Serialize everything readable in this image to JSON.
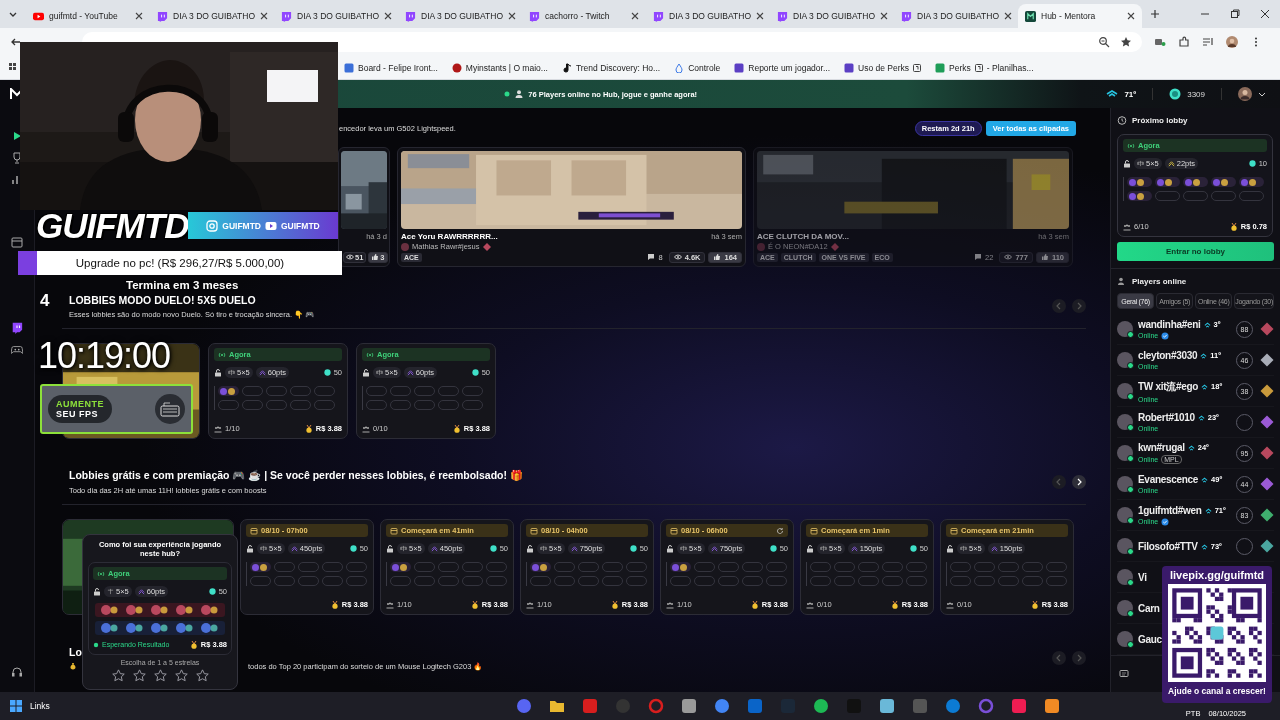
{
  "browser": {
    "tabs": [
      {
        "title": "guifmtd - YouTube",
        "kind": "youtube",
        "selected": false
      },
      {
        "title": "DIA 3 DO GUIBATHO",
        "kind": "twitch",
        "selected": false
      },
      {
        "title": "DIA 3 DO GUIBATHO",
        "kind": "twitch",
        "selected": false
      },
      {
        "title": "DIA 3 DO GUIBATHO",
        "kind": "twitch",
        "selected": false
      },
      {
        "title": "cachorro - Twitch",
        "kind": "twitch",
        "selected": false
      },
      {
        "title": "DIA 3 DO GUIBATHO",
        "kind": "twitch",
        "selected": false
      },
      {
        "title": "DIA 3 DO GUIBATHO",
        "kind": "twitch",
        "selected": false
      },
      {
        "title": "DIA 3 DO GUIBATHO",
        "kind": "twitch",
        "selected": false
      },
      {
        "title": "Hub - Mentora",
        "kind": "mentora",
        "selected": true
      }
    ],
    "bookmarks": [
      {
        "label": "Board - Felipe Iront..."
      },
      {
        "label": "Myinstants | O maio..."
      },
      {
        "label": "Trend Discovery: Ho..."
      },
      {
        "label": "Controle"
      },
      {
        "label": "Reporte um jogador..."
      },
      {
        "label": "Uso de Perks",
        "boxed": true
      },
      {
        "label": "Perks",
        "boxed": true,
        "suffix": "- Planilhas..."
      }
    ]
  },
  "hub": {
    "banner": "76 Players online no Hub, jogue e ganhe agora!",
    "xp": "71º",
    "coins": "3309",
    "clips": {
      "caption": "encedor leva um G502 Lightspeed.",
      "countdown": "Restam 2d 21h",
      "view_all": "Ver todas as clipadas",
      "items": [
        {
          "time": "há 3 d",
          "views": "51",
          "likes": "3",
          "dimmed": false
        },
        {
          "title": "Ace Yoru RAWRRRRRR...",
          "time": "há 3 sem",
          "author": "Mathias Rawr#jesus",
          "tags": [
            "ACE"
          ],
          "comments": "8",
          "views": "4.6K",
          "likes": "164",
          "dimmed": false
        },
        {
          "title": "ACE CLUTCH DA MOV...",
          "time": "há 3 sem",
          "author": "É O NEON#DA12",
          "tags": [
            "ACE",
            "CLUTCH",
            "ONE VS FIVE",
            "ECO"
          ],
          "comments": "22",
          "views": "777",
          "likes": "110",
          "dimmed": true
        }
      ]
    },
    "sections": [
      {
        "number": "4",
        "title": "LOBBIES MODO DUELO! 5X5 DUELO",
        "description": "Esses lobbies são do modo novo Duelo. Só tiro e trocação sincera. 👇 🎮",
        "next_enabled": false,
        "cards": [
          {
            "kind": "picture"
          },
          {
            "kind": "live-lobby",
            "header": "Agora",
            "mode": "5×5",
            "points": "60pts",
            "entry": "50",
            "slots": [
              true,
              false,
              false,
              false,
              false,
              false,
              false,
              false,
              false,
              false
            ],
            "count": "1/10",
            "prize": "R$ 3.88"
          },
          {
            "kind": "live-lobby",
            "header": "Agora",
            "mode": "5×5",
            "points": "60pts",
            "entry": "50",
            "slots": [
              false,
              false,
              false,
              false,
              false,
              false,
              false,
              false,
              false,
              false
            ],
            "count": "0/10",
            "prize": "R$ 3.88"
          }
        ]
      },
      {
        "title": "Lobbies grátis e com premiação 🎮 ☕ | Se você perder nesses lobbies, é reembolsado! 🎁",
        "description": "Todo dia das 2H até umas 11H! lobbies grátis e com boosts",
        "next_enabled": true,
        "cards": [
          {
            "kind": "picture"
          },
          {
            "kind": "scheduled-lobby",
            "header": "08/10 - 07h00",
            "mode": "5×5",
            "points": "450pts",
            "entry": "50",
            "slots": [
              true,
              false,
              false,
              false,
              false,
              false,
              false,
              false,
              false,
              false
            ],
            "prize": "R$ 3.88"
          },
          {
            "kind": "scheduled-lobby",
            "header": "Começará em 41min",
            "mode": "5×5",
            "points": "450pts",
            "entry": "50",
            "slots": [
              true,
              false,
              false,
              false,
              false,
              false,
              false,
              false,
              false,
              false
            ],
            "count": "1/10",
            "prize": "R$ 3.88"
          },
          {
            "kind": "scheduled-lobby",
            "header": "08/10 - 04h00",
            "mode": "5×5",
            "points": "750pts",
            "entry": "50",
            "slots": [
              true,
              false,
              false,
              false,
              false,
              false,
              false,
              false,
              false,
              false
            ],
            "count": "1/10",
            "prize": "R$ 3.88"
          },
          {
            "kind": "scheduled-lobby",
            "header": "08/10 - 06h00",
            "refresh": true,
            "mode": "5×5",
            "points": "750pts",
            "entry": "50",
            "slots": [
              true,
              false,
              false,
              false,
              false,
              false,
              false,
              false,
              false,
              false
            ],
            "count": "1/10",
            "prize": "R$ 3.88"
          },
          {
            "kind": "scheduled-lobby",
            "header": "Começará em 1min",
            "mode": "5×5",
            "points": "150pts",
            "entry": "50",
            "slots": [
              false,
              false,
              false,
              false,
              false,
              false,
              false,
              false,
              false,
              false
            ],
            "count": "0/10",
            "prize": "R$ 3.88"
          },
          {
            "kind": "scheduled-lobby",
            "header": "Começará em 21min",
            "mode": "5×5",
            "points": "150pts",
            "slots": [
              false,
              false,
              false,
              false,
              false,
              false,
              false,
              false,
              false,
              false
            ],
            "count": "0/10",
            "prize": "R$ 3.88"
          }
        ]
      },
      {
        "title": "Lo",
        "description": "todos do Top 20 participam do sorteio de um Mouse Logitech G203 🔥",
        "next_enabled": false
      }
    ],
    "next_lobby": {
      "title": "Próximo lobby",
      "header": "Agora",
      "mode": "5×5",
      "points": "22pts",
      "entry": "10",
      "slots": [
        true,
        true,
        true,
        true,
        true,
        true,
        false,
        false,
        false,
        false
      ],
      "count": "6/10",
      "prize": "R$ 0.78",
      "join": "Entrar no lobby"
    },
    "players": {
      "title": "Players online",
      "tabs": [
        {
          "label": "Geral (76)",
          "selected": true
        },
        {
          "label": "Amigos (5)",
          "selected": false
        },
        {
          "label": "Online (46)",
          "selected": false
        },
        {
          "label": "Jogando (30)",
          "selected": false
        }
      ],
      "list": [
        {
          "name": "wandinha#eni",
          "rank": "3º",
          "status": "Online",
          "verified": true,
          "badge": "88",
          "color": "#b8485e"
        },
        {
          "name": "cleyton#3030",
          "rank": "11º",
          "status": "Online",
          "verified": false,
          "badge": "46",
          "color": "#a9adb8"
        },
        {
          "name": "TW xit流#ego",
          "rank": "18º",
          "status": "Online",
          "verified": false,
          "badge": "38",
          "color": "#c99a3c"
        },
        {
          "name": "Robert#1010",
          "rank": "23º",
          "status": "Online",
          "verified": false,
          "color": "#9b5ad6"
        },
        {
          "name": "kwn#rugal",
          "rank": "24º",
          "status": "Online",
          "verified": false,
          "tag": "MPL",
          "badge": "95",
          "color": "#b8485e"
        },
        {
          "name": "Evanescence",
          "rank": "49º",
          "status": "Online",
          "verified": false,
          "badge": "44",
          "color": "#9b5ad6"
        },
        {
          "name": "1guifmtd#wen",
          "rank": "71º",
          "status": "Online",
          "verified": true,
          "badge": "83",
          "color": "#3fae6e"
        },
        {
          "name": "Filosofo#TTV",
          "rank": "73º",
          "color": "#4aa6a0"
        },
        {
          "name": "Vi"
        },
        {
          "name": "Carn"
        },
        {
          "name": "Gauc"
        }
      ]
    },
    "rating_popup": {
      "question": "Como foi sua experiência jogando neste hub?",
      "header": "Agora",
      "mode": "5×5",
      "points": "60pts",
      "entry": "50",
      "result": "Esperando Resultado",
      "prize": "R$ 3.88",
      "hint": "Escolha de 1 a 5 estrelas",
      "stars": 0
    }
  },
  "overlay": {
    "logo": "GUIFMTD",
    "handles": [
      "GUIFMTD",
      "GUIFMTD"
    ],
    "goal": {
      "label": "Upgrade no pc! (R$ 296,27/R$ 5.000,00)",
      "level": 0.06
    },
    "countdown": "Termina em 3 meses",
    "clock": "10:19:00",
    "ad": {
      "line_1": "AUMENTE",
      "line_2": "SEU FPS"
    },
    "donation": {
      "url": "livepix.gg/guifmtd",
      "cta": "Ajude o canal a crescer!"
    }
  },
  "taskbar": {
    "label": "Links",
    "language": "PTB",
    "date": "08/10/2025"
  }
}
